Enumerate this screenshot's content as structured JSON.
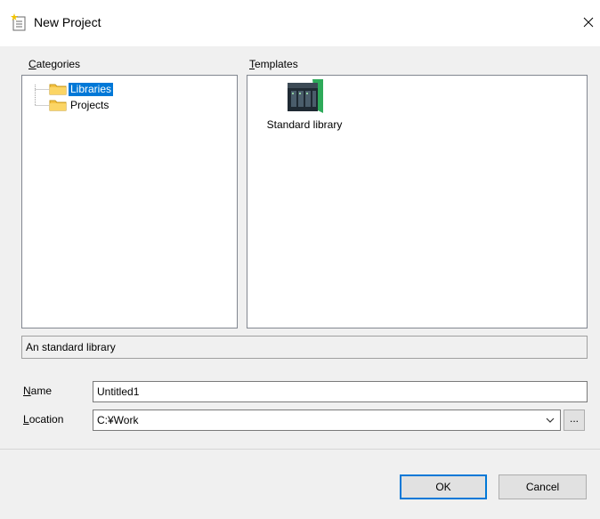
{
  "window": {
    "title": "New Project",
    "icon": "new-project-icon",
    "close_icon": "close-icon"
  },
  "categories": {
    "label": "Categories",
    "items": [
      {
        "label": "Libraries",
        "icon": "folder-icon",
        "selected": true
      },
      {
        "label": "Projects",
        "icon": "folder-icon",
        "selected": false
      }
    ]
  },
  "templates": {
    "label": "Templates",
    "items": [
      {
        "label": "Standard library",
        "icon": "standard-library-icon"
      }
    ]
  },
  "description": "An standard library",
  "form": {
    "name_label": "Name",
    "name_value": "Untitled1",
    "location_label": "Location",
    "location_value": "C:¥Work",
    "browse_label": "..."
  },
  "buttons": {
    "ok": "OK",
    "cancel": "Cancel"
  },
  "colors": {
    "selection": "#0078d7",
    "folder": "#f5c242",
    "device_accent": "#2eaa5a"
  }
}
